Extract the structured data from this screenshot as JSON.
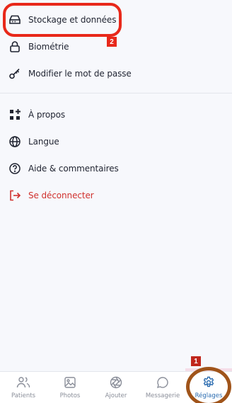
{
  "menu": {
    "items": [
      {
        "label": "Stockage et données",
        "icon": "storage-icon"
      },
      {
        "label": "Biométrie",
        "icon": "lock-icon"
      },
      {
        "label": "Modifier le mot de passe",
        "icon": "key-icon"
      },
      {
        "label": "À propos",
        "icon": "about-icon"
      },
      {
        "label": "Langue",
        "icon": "globe-icon"
      },
      {
        "label": "Aide & commentaires",
        "icon": "help-icon"
      },
      {
        "label": "Se déconnecter",
        "icon": "logout-icon"
      }
    ]
  },
  "annotations": {
    "badge_1": "1",
    "badge_2": "2"
  },
  "tabbar": {
    "tabs": [
      {
        "label": "Patients",
        "icon": "patients-icon"
      },
      {
        "label": "Photos",
        "icon": "photos-icon"
      },
      {
        "label": "Ajouter",
        "icon": "camera-shutter-icon"
      },
      {
        "label": "Messagerie",
        "icon": "chat-bubble-icon"
      },
      {
        "label": "Réglages",
        "icon": "gear-icon",
        "active": true
      }
    ]
  },
  "colors": {
    "danger": "#d0312d",
    "active_tab": "#2b6cb0",
    "annotation": "#e8281a"
  }
}
